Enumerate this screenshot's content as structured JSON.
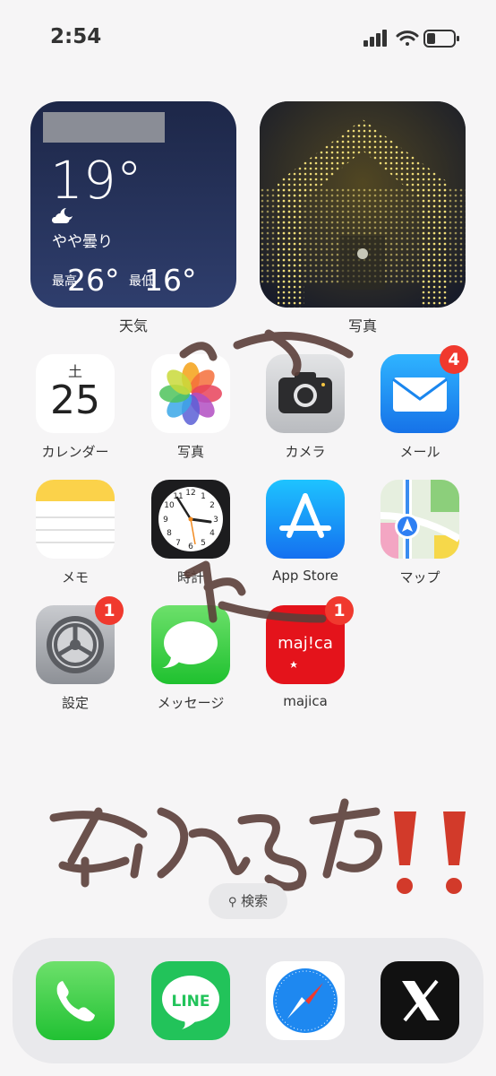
{
  "status_bar": {
    "time": "2:54"
  },
  "widgets": {
    "weather": {
      "temperature": "19°",
      "condition": "やや曇り",
      "high_prefix": "最高",
      "high": "26°",
      "low_prefix": "最低",
      "low": "16°",
      "label": "天気"
    },
    "photos": {
      "label": "写真"
    }
  },
  "apps": {
    "calendar": {
      "weekday": "土",
      "day": "25",
      "label": "カレンダー"
    },
    "photos": {
      "label": "写真"
    },
    "camera": {
      "label": "カメラ"
    },
    "mail": {
      "label": "メール",
      "badge": "4"
    },
    "notes": {
      "label": "メモ"
    },
    "clock": {
      "label": "時計"
    },
    "app_store": {
      "label": "App Store"
    },
    "maps": {
      "label": "マップ"
    },
    "settings": {
      "label": "設定",
      "badge": "1"
    },
    "messages": {
      "label": "メッセージ"
    },
    "majica": {
      "label": "majica",
      "badge": "1",
      "logo_text": "maj!ca"
    }
  },
  "search": {
    "label": "検索"
  },
  "dock": {
    "line_text": "LINE"
  },
  "colors": {
    "badge": "#f0392e",
    "handwriting": "#5b3f3a",
    "exclaim": "#d23a2a"
  }
}
